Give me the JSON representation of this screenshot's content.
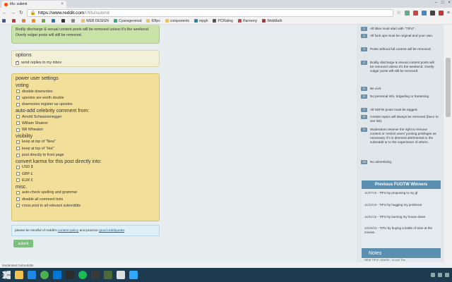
{
  "browser": {
    "tab_title": "tifu: submit",
    "url_host": "https://www.reddit.com",
    "url_path": "/r/tifu/submit",
    "bookmarks": [
      "",
      "",
      "",
      "",
      "",
      "",
      "",
      "",
      "WEB DESIGN",
      "Cyanogenmod",
      "60fps",
      "components",
      "mpgh",
      "PCRating",
      "Harmony",
      "WebMath"
    ]
  },
  "main": {
    "green_notice": "Bodily discharge & sexual content posts will be removed unless it's the weekend. Overly vulgar posts will still be removed.",
    "options": {
      "title": "options",
      "send_replies": "send replies to my inbox"
    },
    "power_user": {
      "title": "power user settings",
      "voting": "voting",
      "disable_downvotes": "disable downvotes",
      "upvotes_double": "upvotes are worth double",
      "downvotes_as_upvotes": "downvotes register as upvotes",
      "celebrity": "auto-add celebrity comment from:",
      "arnold": "Arnold Schwarzenegger",
      "shatner": "William Shatner",
      "wheaton": "Wil Wheaton",
      "visibility": "visibility",
      "top_new": "keep at top of \"New\"",
      "top_hot": "keep at top of \"Hot\"",
      "front_page": "post directly to front page",
      "karma": "convert karma for this post directly into:",
      "usd": "USD $",
      "gbp": "GBP £",
      "eur": "EUR €",
      "misc": "misc.",
      "spell": "auto-check spelling and grammar",
      "disable_bots": "disable all comment bots",
      "crosspost": "cross post to all relevant subreddits"
    },
    "notice_prefix": "please be mindful of reddit's",
    "notice_link1": "content policy",
    "notice_mid": "and practice",
    "notice_link2": "good reddiquette",
    "notice_end": ".",
    "submit": "submit"
  },
  "sidebar": {
    "rules": [
      {
        "num": "1",
        "text": "All titles must start with \"TIFU\"."
      },
      {
        "num": "2",
        "text": "All fuck ups must be original and your own."
      },
      {
        "num": "3",
        "text": "Posts without full context will be removed."
      },
      {
        "num": "4",
        "text": "Bodily discharge & sexual content posts will be removed unless it's the weekend. Overly vulgar posts will still be removed."
      },
      {
        "num": "5",
        "text": "Be civil."
      },
      {
        "num": "6",
        "text": "No personal info, brigading or harassing"
      },
      {
        "num": "7",
        "text": "All NSFW posts must be tagged."
      },
      {
        "num": "8",
        "text": "Certain topics will always be removed (favor to see list)."
      },
      {
        "num": "9",
        "text": "Moderators reserve the right to remove content or restrict users' posting privileges as necessary if it is deemed detrimental to the subreddit or to the experience of others."
      },
      {
        "num": "10",
        "text": "No advertising."
      }
    ],
    "fuotw_title": "Previous FUOTW Winners",
    "fuotw": [
      {
        "date": "11/07/15",
        "text": "- TIFU by proposing to my gf"
      },
      {
        "date": "11/22/15",
        "text": "- TIFU by hugging my professor"
      },
      {
        "date": "11/01/15",
        "text": "- TIFU by burning my house down"
      },
      {
        "date": "10/25/15",
        "text": "- TIFU by buying a bottle of wine at the movies"
      }
    ],
    "notes_title": "Notes",
    "notes_sub": "NEW TIFU! LEARN... is out! The"
  },
  "status_bar": "Moderated Subreddits"
}
